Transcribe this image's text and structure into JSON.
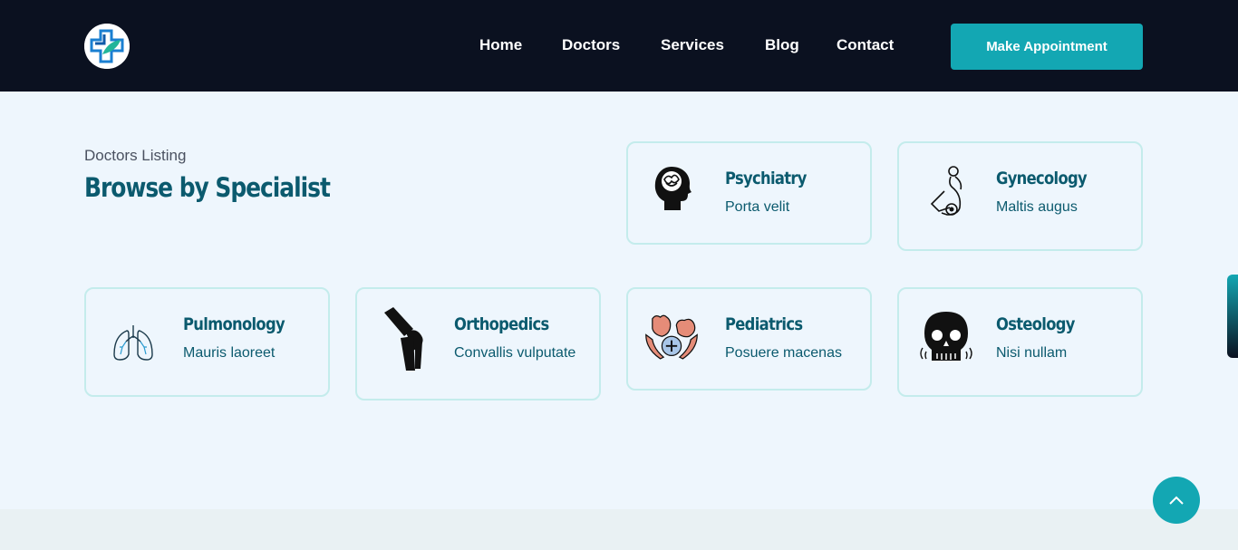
{
  "nav": {
    "logo_icon": "medical-cross-logo",
    "links": [
      "Home",
      "Doctors",
      "Services",
      "Blog",
      "Contact"
    ],
    "cta_label": "Make Appointment"
  },
  "section": {
    "eyebrow": "Doctors Listing",
    "heading": "Browse by Specialist"
  },
  "specialists": [
    {
      "title": "Psychiatry",
      "subtitle": "Porta velit",
      "icon": "brain-head-icon"
    },
    {
      "title": "Gynecology",
      "subtitle": "Maltis augus",
      "icon": "pregnant-woman-icon"
    },
    {
      "title": "Pulmonology",
      "subtitle": "Mauris laoreet",
      "icon": "lungs-icon"
    },
    {
      "title": "Orthopedics",
      "subtitle": "Convallis vulputate",
      "icon": "knee-joint-icon"
    },
    {
      "title": "Pediatrics",
      "subtitle": "Posuere macenas",
      "icon": "baby-hands-icon"
    },
    {
      "title": "Osteology",
      "subtitle": "Nisi nullam",
      "icon": "skull-icon"
    }
  ],
  "colors": {
    "navbar_bg": "#0b1120",
    "accent": "#13a7b3",
    "heading": "#0b5a6e",
    "page_bg": "#eef6fd",
    "card_border": "#c4ecec"
  }
}
